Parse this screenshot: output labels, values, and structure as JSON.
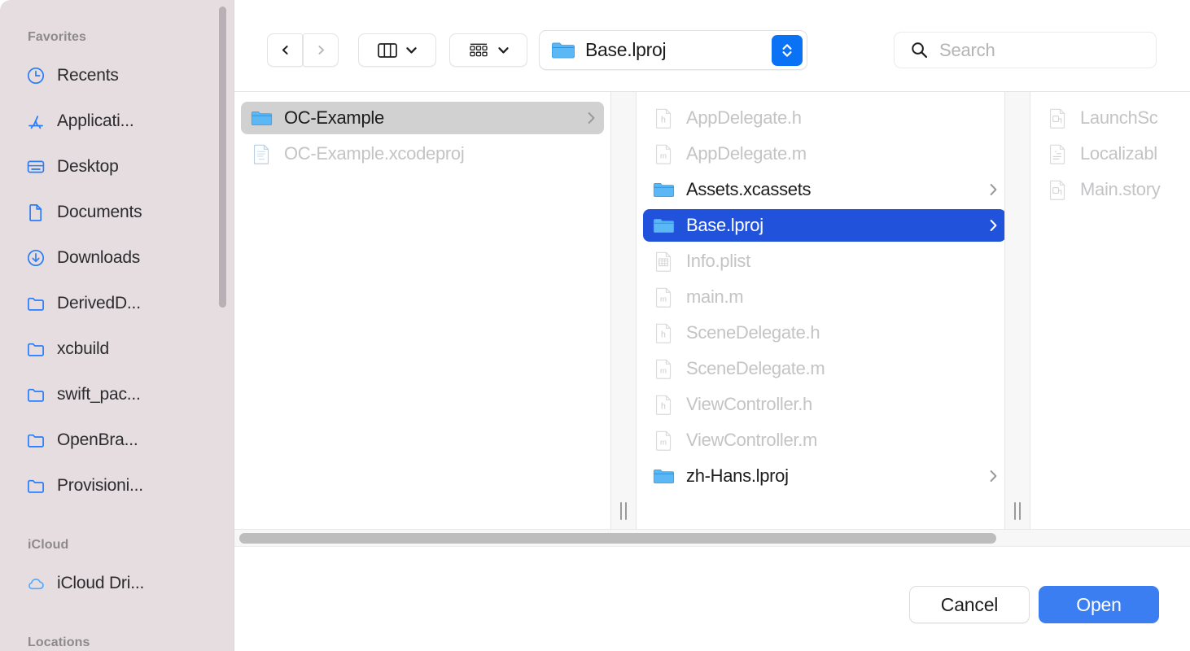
{
  "sidebar": {
    "sections": [
      {
        "title": "Favorites"
      },
      {
        "title": "iCloud"
      },
      {
        "title": "Locations"
      }
    ],
    "favorites": [
      {
        "label": "Recents",
        "icon": "clock-icon"
      },
      {
        "label": "Applicati...",
        "icon": "appstore-icon"
      },
      {
        "label": "Desktop",
        "icon": "desktop-icon"
      },
      {
        "label": "Documents",
        "icon": "document-icon"
      },
      {
        "label": "Downloads",
        "icon": "download-icon"
      },
      {
        "label": "DerivedD...",
        "icon": "folder-icon"
      },
      {
        "label": "xcbuild",
        "icon": "folder-icon"
      },
      {
        "label": "swift_pac...",
        "icon": "folder-icon"
      },
      {
        "label": "OpenBra...",
        "icon": "folder-icon"
      },
      {
        "label": "Provisioni...",
        "icon": "folder-icon"
      }
    ],
    "icloud": [
      {
        "label": "iCloud Dri...",
        "icon": "cloud-icon"
      }
    ]
  },
  "toolbar": {
    "back_icon": "chevron-left-icon",
    "forward_icon": "chevron-right-icon",
    "view_icon": "column-view-icon",
    "view_chevron_icon": "chevron-down-icon",
    "group_icon": "group-by-icon",
    "group_chevron_icon": "chevron-down-icon",
    "path_label": "Base.lproj",
    "path_icon": "folder-icon",
    "path_stepper_icon": "up-down-chevron-icon",
    "search_icon": "search-icon",
    "search_value": "",
    "search_placeholder": "Search"
  },
  "browser": {
    "columns": [
      {
        "name": "column-1",
        "items": [
          {
            "label": "OC-Example",
            "icon": "folder-icon",
            "state": "selected-gray",
            "disclosure": true
          },
          {
            "label": "OC-Example.xcodeproj",
            "icon": "xcodeproj-icon",
            "state": "dim",
            "disclosure": false
          }
        ]
      },
      {
        "name": "column-2",
        "items": [
          {
            "label": "AppDelegate.h",
            "icon": "h-file-icon",
            "state": "dim",
            "disclosure": false
          },
          {
            "label": "AppDelegate.m",
            "icon": "m-file-icon",
            "state": "dim",
            "disclosure": false
          },
          {
            "label": "Assets.xcassets",
            "icon": "folder-icon",
            "state": "normal",
            "disclosure": true
          },
          {
            "label": "Base.lproj",
            "icon": "folder-icon",
            "state": "selected-blue",
            "disclosure": true
          },
          {
            "label": "Info.plist",
            "icon": "plist-file-icon",
            "state": "dim",
            "disclosure": false
          },
          {
            "label": "main.m",
            "icon": "m-file-icon",
            "state": "dim",
            "disclosure": false
          },
          {
            "label": "SceneDelegate.h",
            "icon": "h-file-icon",
            "state": "dim",
            "disclosure": false
          },
          {
            "label": "SceneDelegate.m",
            "icon": "m-file-icon",
            "state": "dim",
            "disclosure": false
          },
          {
            "label": "ViewController.h",
            "icon": "h-file-icon",
            "state": "dim",
            "disclosure": false
          },
          {
            "label": "ViewController.m",
            "icon": "m-file-icon",
            "state": "dim",
            "disclosure": false
          },
          {
            "label": "zh-Hans.lproj",
            "icon": "folder-icon",
            "state": "normal",
            "disclosure": true
          }
        ]
      },
      {
        "name": "column-3",
        "items": [
          {
            "label": "LaunchSc",
            "icon": "storyboard-file-icon",
            "state": "dim",
            "disclosure": false
          },
          {
            "label": "Localizabl",
            "icon": "strings-file-icon",
            "state": "dim",
            "disclosure": false
          },
          {
            "label": "Main.story",
            "icon": "storyboard-file-icon",
            "state": "dim",
            "disclosure": false
          }
        ]
      }
    ],
    "resize_grip_icon": "column-resize-grip-icon",
    "h_scrollbar": "horizontal-scrollbar"
  },
  "footer": {
    "cancel_label": "Cancel",
    "open_label": "Open"
  },
  "colors": {
    "sidebar_bg": "#e6dde1",
    "selection_blue": "#2052dc",
    "selection_gray": "#d1d1d1",
    "accent_blue": "#0a72f5",
    "open_button_blue": "#3b7ef2",
    "icon_blue": "#2b7cf6",
    "disabled_text": "#c4c4c6"
  }
}
